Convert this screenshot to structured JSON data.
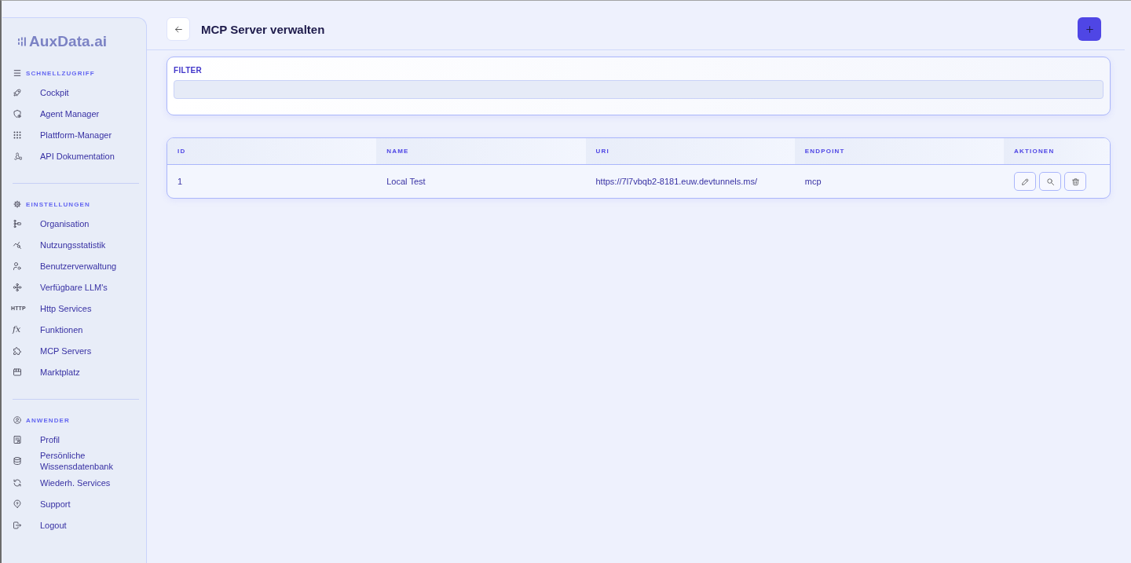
{
  "logo": {
    "text": "AuxData.ai"
  },
  "sidebar": {
    "sections": [
      {
        "title": "SCHNELLZUGRIFF",
        "items": [
          {
            "label": "Cockpit"
          },
          {
            "label": "Agent Manager"
          },
          {
            "label": "Plattform-Manager"
          },
          {
            "label": "API Dokumentation"
          }
        ]
      },
      {
        "title": "EINSTELLUNGEN",
        "items": [
          {
            "label": "Organisation"
          },
          {
            "label": "Nutzungsstatistik"
          },
          {
            "label": "Benutzerverwaltung"
          },
          {
            "label": "Verfügbare LLM's"
          },
          {
            "label": "Http Services",
            "icon_text": "HTTP"
          },
          {
            "label": "Funktionen",
            "icon_text": "fx"
          },
          {
            "label": "MCP Servers"
          },
          {
            "label": "Marktplatz"
          }
        ]
      },
      {
        "title": "ANWENDER",
        "items": [
          {
            "label": "Profil"
          },
          {
            "label": "Persönliche Wissensdatenbank"
          },
          {
            "label": "Wiederh. Services"
          },
          {
            "label": "Support"
          },
          {
            "label": "Logout"
          }
        ]
      }
    ]
  },
  "header": {
    "title": "MCP Server verwalten"
  },
  "filter": {
    "label": "FILTER"
  },
  "table": {
    "columns": [
      "ID",
      "NAME",
      "URI",
      "ENDPOINT",
      "AKTIONEN"
    ],
    "rows": [
      {
        "cells": [
          "1",
          "Local Test",
          "https://7l7vbqb2-8181.euw.devtunnels.ms/",
          "mcp"
        ]
      }
    ]
  }
}
